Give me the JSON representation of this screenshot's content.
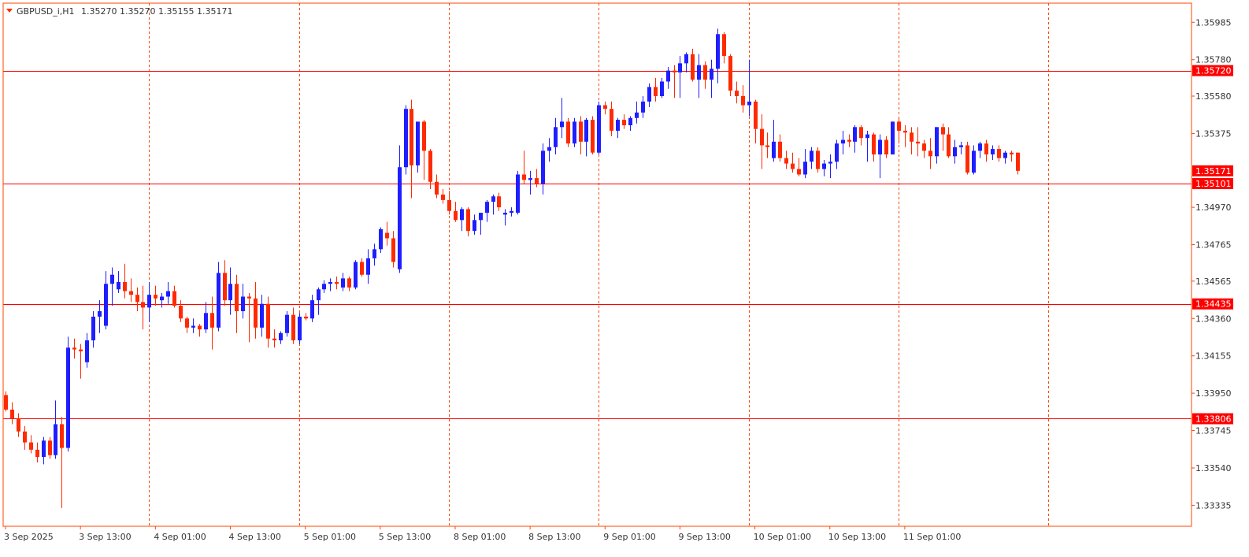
{
  "colors": {
    "frame": "#FF4500",
    "grid": "#FF4500",
    "bull": "#1E1EFF",
    "bear": "#FF2A00",
    "hline": "#FF0000",
    "text": "#333333",
    "badge_text": "#ffffff"
  },
  "header": {
    "indicator_icon": "triangle-down-icon",
    "symbol": "GBPUSD_i,H1",
    "ohlc": "1.35270 1.35270 1.35155 1.35171"
  },
  "chart_data": {
    "type": "candlestick",
    "symbol": "GBPUSD_i",
    "timeframe": "H1",
    "ylim": [
      1.3322,
      1.3609
    ],
    "y_ticks": [
      "1.35985",
      "1.35780",
      "1.35580",
      "1.35375",
      "1.34970",
      "1.34765",
      "1.34565",
      "1.34360",
      "1.34155",
      "1.33950",
      "1.33745",
      "1.33540",
      "1.33335"
    ],
    "x_labels": [
      "3 Sep 2025",
      "3 Sep 13:00",
      "4 Sep 01:00",
      "4 Sep 13:00",
      "5 Sep 01:00",
      "5 Sep 13:00",
      "8 Sep 01:00",
      "8 Sep 13:00",
      "9 Sep 01:00",
      "9 Sep 13:00",
      "10 Sep 01:00",
      "10 Sep 13:00",
      "11 Sep 01:00"
    ],
    "x_label_bar_index": [
      0,
      12,
      24,
      36,
      48,
      60,
      72,
      84,
      96,
      108,
      120,
      132,
      144
    ],
    "grid_vertical_bar_index": [
      23,
      47,
      71,
      95,
      119,
      143,
      167
    ],
    "horizontal_lines": [
      {
        "price": 1.3572,
        "label": "1.35720"
      },
      {
        "price": 1.351,
        "label": "1.35101"
      },
      {
        "price": 1.3444,
        "label": "1.34435"
      },
      {
        "price": 1.3381,
        "label": "1.33806"
      }
    ],
    "last_price": {
      "price": 1.3517,
      "label": "1.35171"
    },
    "candles": [
      {
        "o": 1.3394,
        "h": 1.3396,
        "l": 1.3385,
        "c": 1.3386
      },
      {
        "o": 1.3386,
        "h": 1.339,
        "l": 1.3378,
        "c": 1.3381
      },
      {
        "o": 1.3381,
        "h": 1.3384,
        "l": 1.3371,
        "c": 1.3374
      },
      {
        "o": 1.3374,
        "h": 1.3377,
        "l": 1.3364,
        "c": 1.3368
      },
      {
        "o": 1.3368,
        "h": 1.3372,
        "l": 1.3362,
        "c": 1.3364
      },
      {
        "o": 1.3364,
        "h": 1.3368,
        "l": 1.3357,
        "c": 1.336
      },
      {
        "o": 1.336,
        "h": 1.3371,
        "l": 1.3356,
        "c": 1.3369
      },
      {
        "o": 1.3369,
        "h": 1.3371,
        "l": 1.3359,
        "c": 1.3361
      },
      {
        "o": 1.3361,
        "h": 1.3391,
        "l": 1.3359,
        "c": 1.3378
      },
      {
        "o": 1.3378,
        "h": 1.3382,
        "l": 1.3332,
        "c": 1.3365
      },
      {
        "o": 1.3365,
        "h": 1.3426,
        "l": 1.3363,
        "c": 1.342
      },
      {
        "o": 1.342,
        "h": 1.3425,
        "l": 1.3414,
        "c": 1.3419
      },
      {
        "o": 1.3419,
        "h": 1.3422,
        "l": 1.3403,
        "c": 1.3418
      },
      {
        "o": 1.3412,
        "h": 1.3428,
        "l": 1.3409,
        "c": 1.3424
      },
      {
        "o": 1.3424,
        "h": 1.344,
        "l": 1.342,
        "c": 1.3437
      },
      {
        "o": 1.3437,
        "h": 1.3446,
        "l": 1.3428,
        "c": 1.344
      },
      {
        "o": 1.3432,
        "h": 1.3462,
        "l": 1.343,
        "c": 1.3455
      },
      {
        "o": 1.3455,
        "h": 1.3464,
        "l": 1.3443,
        "c": 1.346
      },
      {
        "o": 1.3452,
        "h": 1.3462,
        "l": 1.345,
        "c": 1.3456
      },
      {
        "o": 1.3456,
        "h": 1.3466,
        "l": 1.3447,
        "c": 1.3451
      },
      {
        "o": 1.3451,
        "h": 1.3458,
        "l": 1.3445,
        "c": 1.3449
      },
      {
        "o": 1.3449,
        "h": 1.3453,
        "l": 1.344,
        "c": 1.3445
      },
      {
        "o": 1.3445,
        "h": 1.3454,
        "l": 1.343,
        "c": 1.3442
      },
      {
        "o": 1.3442,
        "h": 1.3456,
        "l": 1.3434,
        "c": 1.3449
      },
      {
        "o": 1.3449,
        "h": 1.3454,
        "l": 1.3443,
        "c": 1.3447
      },
      {
        "o": 1.3446,
        "h": 1.345,
        "l": 1.3442,
        "c": 1.3448
      },
      {
        "o": 1.3448,
        "h": 1.3456,
        "l": 1.3444,
        "c": 1.3451
      },
      {
        "o": 1.3451,
        "h": 1.3454,
        "l": 1.3442,
        "c": 1.3443
      },
      {
        "o": 1.3443,
        "h": 1.3446,
        "l": 1.3434,
        "c": 1.3436
      },
      {
        "o": 1.3436,
        "h": 1.3437,
        "l": 1.3428,
        "c": 1.3431
      },
      {
        "o": 1.3431,
        "h": 1.3436,
        "l": 1.3428,
        "c": 1.3432
      },
      {
        "o": 1.3432,
        "h": 1.3433,
        "l": 1.3426,
        "c": 1.343
      },
      {
        "o": 1.343,
        "h": 1.3445,
        "l": 1.3428,
        "c": 1.3439
      },
      {
        "o": 1.3439,
        "h": 1.3448,
        "l": 1.3419,
        "c": 1.3431
      },
      {
        "o": 1.3431,
        "h": 1.3467,
        "l": 1.3429,
        "c": 1.3461
      },
      {
        "o": 1.3461,
        "h": 1.3468,
        "l": 1.3443,
        "c": 1.3446
      },
      {
        "o": 1.3446,
        "h": 1.3464,
        "l": 1.3438,
        "c": 1.3455
      },
      {
        "o": 1.3455,
        "h": 1.346,
        "l": 1.3428,
        "c": 1.344
      },
      {
        "o": 1.344,
        "h": 1.3455,
        "l": 1.3436,
        "c": 1.3448
      },
      {
        "o": 1.3448,
        "h": 1.345,
        "l": 1.3423,
        "c": 1.3447
      },
      {
        "o": 1.3447,
        "h": 1.3456,
        "l": 1.3425,
        "c": 1.3431
      },
      {
        "o": 1.3431,
        "h": 1.3449,
        "l": 1.3426,
        "c": 1.3444
      },
      {
        "o": 1.3444,
        "h": 1.3448,
        "l": 1.342,
        "c": 1.3425
      },
      {
        "o": 1.3425,
        "h": 1.343,
        "l": 1.342,
        "c": 1.3424
      },
      {
        "o": 1.3424,
        "h": 1.3429,
        "l": 1.3422,
        "c": 1.3428
      },
      {
        "o": 1.3428,
        "h": 1.344,
        "l": 1.3426,
        "c": 1.3438
      },
      {
        "o": 1.3438,
        "h": 1.3442,
        "l": 1.3422,
        "c": 1.3424
      },
      {
        "o": 1.3424,
        "h": 1.3439,
        "l": 1.3422,
        "c": 1.3437
      },
      {
        "o": 1.3437,
        "h": 1.3439,
        "l": 1.3435,
        "c": 1.3436
      },
      {
        "o": 1.3436,
        "h": 1.3449,
        "l": 1.3434,
        "c": 1.3446
      },
      {
        "o": 1.3446,
        "h": 1.3453,
        "l": 1.3438,
        "c": 1.3452
      },
      {
        "o": 1.3452,
        "h": 1.3457,
        "l": 1.345,
        "c": 1.3455
      },
      {
        "o": 1.3455,
        "h": 1.3458,
        "l": 1.3451,
        "c": 1.3456
      },
      {
        "o": 1.3456,
        "h": 1.3459,
        "l": 1.3452,
        "c": 1.3455
      },
      {
        "o": 1.3453,
        "h": 1.3461,
        "l": 1.3451,
        "c": 1.3458
      },
      {
        "o": 1.3458,
        "h": 1.3459,
        "l": 1.3451,
        "c": 1.3453
      },
      {
        "o": 1.3453,
        "h": 1.3468,
        "l": 1.3452,
        "c": 1.3467
      },
      {
        "o": 1.3467,
        "h": 1.3469,
        "l": 1.3459,
        "c": 1.346
      },
      {
        "o": 1.346,
        "h": 1.3474,
        "l": 1.3455,
        "c": 1.3469
      },
      {
        "o": 1.3469,
        "h": 1.3477,
        "l": 1.3465,
        "c": 1.3474
      },
      {
        "o": 1.3474,
        "h": 1.3486,
        "l": 1.3472,
        "c": 1.3485
      },
      {
        "o": 1.3483,
        "h": 1.3489,
        "l": 1.3476,
        "c": 1.348
      },
      {
        "o": 1.348,
        "h": 1.3484,
        "l": 1.3464,
        "c": 1.3467
      },
      {
        "o": 1.3463,
        "h": 1.3531,
        "l": 1.3461,
        "c": 1.3519
      },
      {
        "o": 1.3519,
        "h": 1.3553,
        "l": 1.3515,
        "c": 1.3551
      },
      {
        "o": 1.3551,
        "h": 1.3556,
        "l": 1.3502,
        "c": 1.352
      },
      {
        "o": 1.352,
        "h": 1.3541,
        "l": 1.3516,
        "c": 1.3544
      },
      {
        "o": 1.3544,
        "h": 1.3545,
        "l": 1.3512,
        "c": 1.3528
      },
      {
        "o": 1.3528,
        "h": 1.3529,
        "l": 1.3507,
        "c": 1.3511
      },
      {
        "o": 1.3511,
        "h": 1.3515,
        "l": 1.3502,
        "c": 1.3504
      },
      {
        "o": 1.3504,
        "h": 1.3507,
        "l": 1.3499,
        "c": 1.3501
      },
      {
        "o": 1.3501,
        "h": 1.3506,
        "l": 1.3493,
        "c": 1.3495
      },
      {
        "o": 1.3495,
        "h": 1.35,
        "l": 1.3489,
        "c": 1.349
      },
      {
        "o": 1.349,
        "h": 1.3497,
        "l": 1.3484,
        "c": 1.3496
      },
      {
        "o": 1.3496,
        "h": 1.3497,
        "l": 1.3481,
        "c": 1.3484
      },
      {
        "o": 1.3484,
        "h": 1.3493,
        "l": 1.3482,
        "c": 1.349
      },
      {
        "o": 1.349,
        "h": 1.3494,
        "l": 1.3482,
        "c": 1.3494
      },
      {
        "o": 1.3494,
        "h": 1.3501,
        "l": 1.3489,
        "c": 1.35
      },
      {
        "o": 1.35,
        "h": 1.3504,
        "l": 1.3493,
        "c": 1.3503
      },
      {
        "o": 1.3503,
        "h": 1.3505,
        "l": 1.3495,
        "c": 1.3497
      },
      {
        "o": 1.3493,
        "h": 1.3496,
        "l": 1.3487,
        "c": 1.3494
      },
      {
        "o": 1.3494,
        "h": 1.3497,
        "l": 1.3492,
        "c": 1.3495
      },
      {
        "o": 1.3494,
        "h": 1.3517,
        "l": 1.3493,
        "c": 1.3515
      },
      {
        "o": 1.3515,
        "h": 1.3528,
        "l": 1.351,
        "c": 1.3512
      },
      {
        "o": 1.3512,
        "h": 1.3517,
        "l": 1.3504,
        "c": 1.3513
      },
      {
        "o": 1.3513,
        "h": 1.3518,
        "l": 1.3508,
        "c": 1.351
      },
      {
        "o": 1.351,
        "h": 1.3532,
        "l": 1.3504,
        "c": 1.3528
      },
      {
        "o": 1.3528,
        "h": 1.3535,
        "l": 1.3522,
        "c": 1.353
      },
      {
        "o": 1.353,
        "h": 1.3546,
        "l": 1.3526,
        "c": 1.3541
      },
      {
        "o": 1.3541,
        "h": 1.3557,
        "l": 1.3535,
        "c": 1.3544
      },
      {
        "o": 1.3544,
        "h": 1.3546,
        "l": 1.353,
        "c": 1.3532
      },
      {
        "o": 1.3532,
        "h": 1.3546,
        "l": 1.353,
        "c": 1.3544
      },
      {
        "o": 1.3544,
        "h": 1.3547,
        "l": 1.3526,
        "c": 1.3533
      },
      {
        "o": 1.3533,
        "h": 1.3546,
        "l": 1.3525,
        "c": 1.3545
      },
      {
        "o": 1.3545,
        "h": 1.3547,
        "l": 1.3526,
        "c": 1.3527
      },
      {
        "o": 1.3527,
        "h": 1.3555,
        "l": 1.3526,
        "c": 1.3553
      },
      {
        "o": 1.3553,
        "h": 1.3555,
        "l": 1.3548,
        "c": 1.3551
      },
      {
        "o": 1.3551,
        "h": 1.3555,
        "l": 1.3536,
        "c": 1.3539
      },
      {
        "o": 1.3539,
        "h": 1.3546,
        "l": 1.3535,
        "c": 1.3545
      },
      {
        "o": 1.3545,
        "h": 1.3548,
        "l": 1.354,
        "c": 1.3542
      },
      {
        "o": 1.3542,
        "h": 1.3547,
        "l": 1.3539,
        "c": 1.3546
      },
      {
        "o": 1.3546,
        "h": 1.3555,
        "l": 1.3543,
        "c": 1.3549
      },
      {
        "o": 1.3549,
        "h": 1.3558,
        "l": 1.3546,
        "c": 1.3555
      },
      {
        "o": 1.3555,
        "h": 1.3565,
        "l": 1.3552,
        "c": 1.3563
      },
      {
        "o": 1.3563,
        "h": 1.3568,
        "l": 1.3555,
        "c": 1.3558
      },
      {
        "o": 1.3558,
        "h": 1.3568,
        "l": 1.3557,
        "c": 1.3566
      },
      {
        "o": 1.3566,
        "h": 1.3574,
        "l": 1.3562,
        "c": 1.3572
      },
      {
        "o": 1.3572,
        "h": 1.3575,
        "l": 1.3557,
        "c": 1.3571
      },
      {
        "o": 1.3571,
        "h": 1.358,
        "l": 1.3557,
        "c": 1.3576
      },
      {
        "o": 1.3576,
        "h": 1.3582,
        "l": 1.3571,
        "c": 1.3581
      },
      {
        "o": 1.3581,
        "h": 1.3584,
        "l": 1.3566,
        "c": 1.3567
      },
      {
        "o": 1.3567,
        "h": 1.3581,
        "l": 1.3557,
        "c": 1.3575
      },
      {
        "o": 1.3575,
        "h": 1.3577,
        "l": 1.3562,
        "c": 1.3567
      },
      {
        "o": 1.3567,
        "h": 1.3578,
        "l": 1.3557,
        "c": 1.3573
      },
      {
        "o": 1.3573,
        "h": 1.3595,
        "l": 1.3565,
        "c": 1.3592
      },
      {
        "o": 1.3592,
        "h": 1.3593,
        "l": 1.3576,
        "c": 1.358
      },
      {
        "o": 1.358,
        "h": 1.3581,
        "l": 1.3558,
        "c": 1.3561
      },
      {
        "o": 1.3561,
        "h": 1.3566,
        "l": 1.3554,
        "c": 1.3558
      },
      {
        "o": 1.3558,
        "h": 1.3564,
        "l": 1.3549,
        "c": 1.3553
      },
      {
        "o": 1.3553,
        "h": 1.3578,
        "l": 1.3547,
        "c": 1.3555
      },
      {
        "o": 1.3555,
        "h": 1.3556,
        "l": 1.3532,
        "c": 1.354
      },
      {
        "o": 1.354,
        "h": 1.3548,
        "l": 1.3518,
        "c": 1.3531
      },
      {
        "o": 1.3531,
        "h": 1.3538,
        "l": 1.3524,
        "c": 1.353
      },
      {
        "o": 1.3524,
        "h": 1.3545,
        "l": 1.3522,
        "c": 1.3533
      },
      {
        "o": 1.3533,
        "h": 1.3537,
        "l": 1.3522,
        "c": 1.3524
      },
      {
        "o": 1.3524,
        "h": 1.3528,
        "l": 1.3518,
        "c": 1.3521
      },
      {
        "o": 1.3521,
        "h": 1.3527,
        "l": 1.3516,
        "c": 1.3518
      },
      {
        "o": 1.3518,
        "h": 1.3524,
        "l": 1.3514,
        "c": 1.3515
      },
      {
        "o": 1.3515,
        "h": 1.3529,
        "l": 1.3513,
        "c": 1.3522
      },
      {
        "o": 1.3522,
        "h": 1.353,
        "l": 1.3518,
        "c": 1.3528
      },
      {
        "o": 1.3528,
        "h": 1.353,
        "l": 1.3516,
        "c": 1.3518
      },
      {
        "o": 1.3518,
        "h": 1.3523,
        "l": 1.3514,
        "c": 1.3521
      },
      {
        "o": 1.3521,
        "h": 1.3526,
        "l": 1.3513,
        "c": 1.3522
      },
      {
        "o": 1.3522,
        "h": 1.3534,
        "l": 1.3518,
        "c": 1.3532
      },
      {
        "o": 1.3532,
        "h": 1.3539,
        "l": 1.3526,
        "c": 1.3534
      },
      {
        "o": 1.3534,
        "h": 1.3537,
        "l": 1.353,
        "c": 1.3533
      },
      {
        "o": 1.3533,
        "h": 1.3542,
        "l": 1.3527,
        "c": 1.3541
      },
      {
        "o": 1.3541,
        "h": 1.3542,
        "l": 1.3531,
        "c": 1.3535
      },
      {
        "o": 1.3535,
        "h": 1.3539,
        "l": 1.3522,
        "c": 1.3537
      },
      {
        "o": 1.3537,
        "h": 1.3538,
        "l": 1.3522,
        "c": 1.3526
      },
      {
        "o": 1.3526,
        "h": 1.3537,
        "l": 1.3513,
        "c": 1.3534
      },
      {
        "o": 1.3534,
        "h": 1.3536,
        "l": 1.3524,
        "c": 1.3526
      },
      {
        "o": 1.3526,
        "h": 1.3544,
        "l": 1.3526,
        "c": 1.3544
      },
      {
        "o": 1.3544,
        "h": 1.3546,
        "l": 1.3532,
        "c": 1.3539
      },
      {
        "o": 1.3539,
        "h": 1.3542,
        "l": 1.353,
        "c": 1.3538
      },
      {
        "o": 1.3538,
        "h": 1.3541,
        "l": 1.3526,
        "c": 1.3533
      },
      {
        "o": 1.3533,
        "h": 1.3541,
        "l": 1.3525,
        "c": 1.3532
      },
      {
        "o": 1.3532,
        "h": 1.3534,
        "l": 1.3524,
        "c": 1.3528
      },
      {
        "o": 1.3528,
        "h": 1.3535,
        "l": 1.3518,
        "c": 1.3525
      },
      {
        "o": 1.3525,
        "h": 1.3541,
        "l": 1.3521,
        "c": 1.3541
      },
      {
        "o": 1.3541,
        "h": 1.3543,
        "l": 1.3528,
        "c": 1.3537
      },
      {
        "o": 1.3537,
        "h": 1.3541,
        "l": 1.3524,
        "c": 1.3525
      },
      {
        "o": 1.3525,
        "h": 1.3534,
        "l": 1.3521,
        "c": 1.353
      },
      {
        "o": 1.353,
        "h": 1.3533,
        "l": 1.3526,
        "c": 1.3531
      },
      {
        "o": 1.3531,
        "h": 1.3533,
        "l": 1.3515,
        "c": 1.3516
      },
      {
        "o": 1.3516,
        "h": 1.3531,
        "l": 1.3515,
        "c": 1.3528
      },
      {
        "o": 1.3528,
        "h": 1.3533,
        "l": 1.3524,
        "c": 1.3532
      },
      {
        "o": 1.3532,
        "h": 1.3534,
        "l": 1.3522,
        "c": 1.3526
      },
      {
        "o": 1.3526,
        "h": 1.3531,
        "l": 1.3523,
        "c": 1.3529
      },
      {
        "o": 1.3529,
        "h": 1.3531,
        "l": 1.3522,
        "c": 1.3524
      },
      {
        "o": 1.3524,
        "h": 1.3528,
        "l": 1.3521,
        "c": 1.3527
      },
      {
        "o": 1.3527,
        "h": 1.3528,
        "l": 1.3522,
        "c": 1.3526
      },
      {
        "o": 1.3527,
        "h": 1.3527,
        "l": 1.3515,
        "c": 1.3517
      }
    ]
  }
}
